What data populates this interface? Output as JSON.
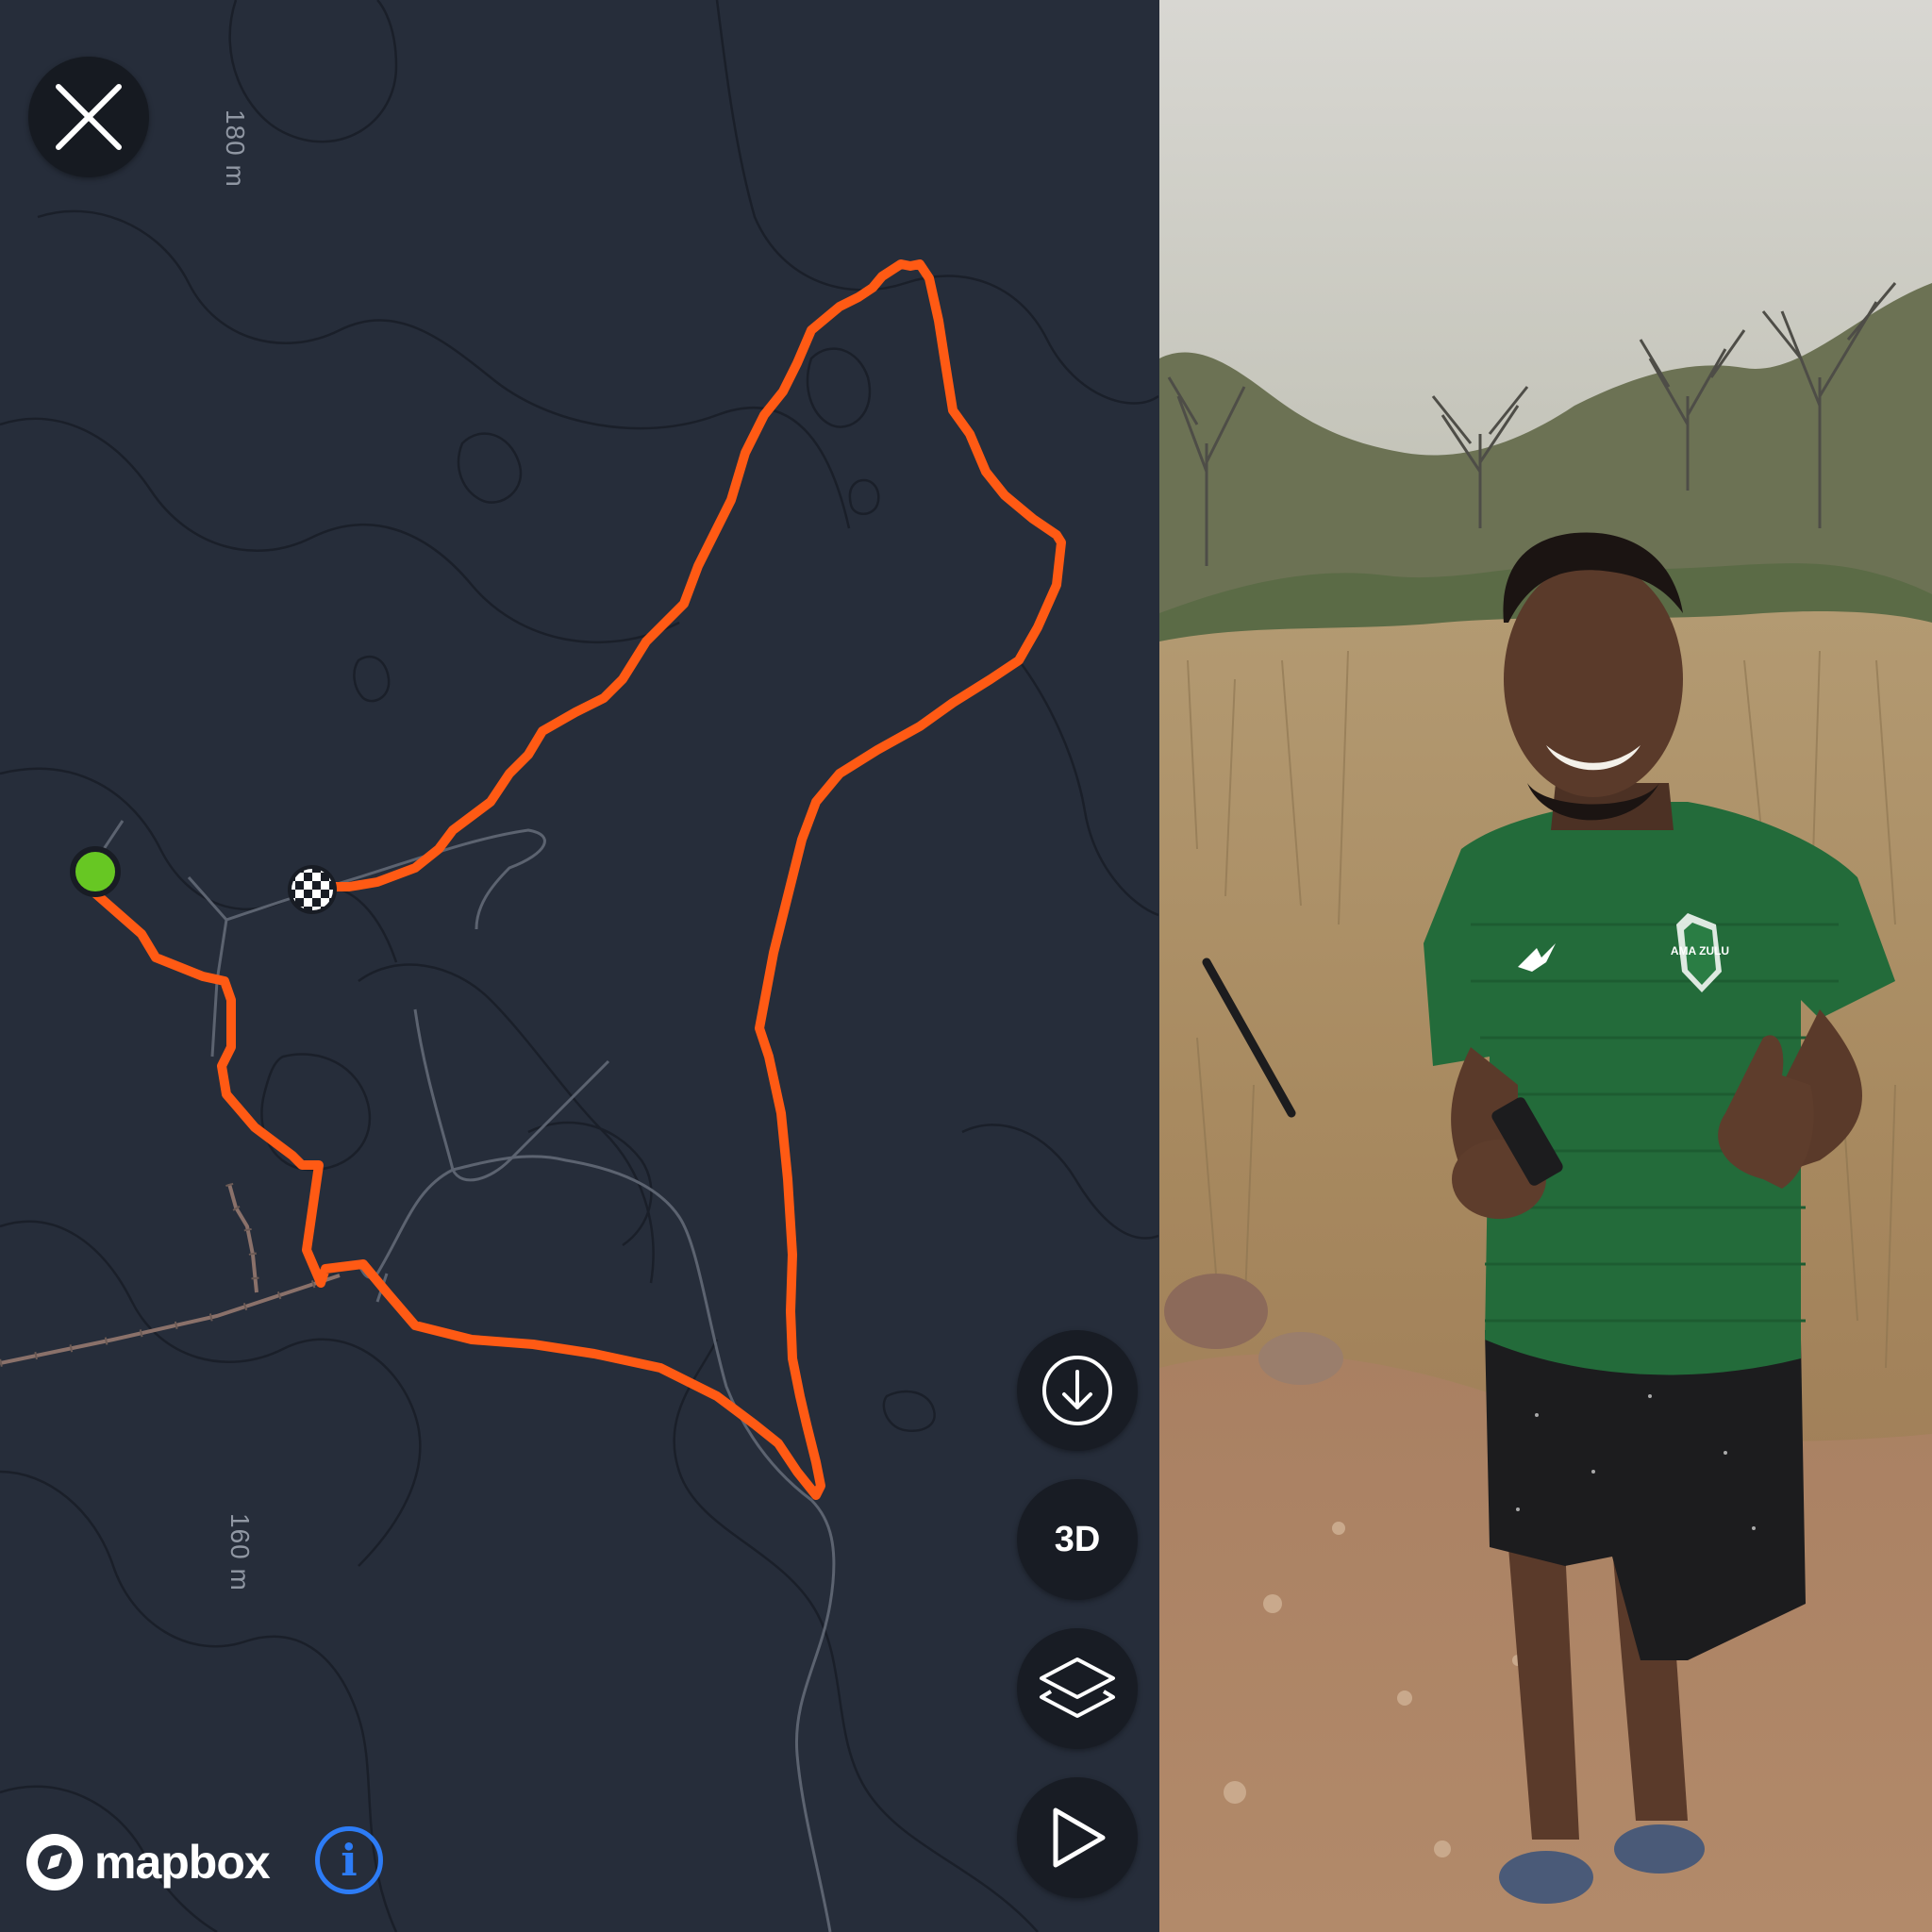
{
  "map": {
    "contour_labels": [
      "180 m",
      "160 m"
    ],
    "track_color": "#ff5a14",
    "start_marker_color": "#67c723",
    "background_color": "#262d3a"
  },
  "controls": {
    "close_icon": "close-icon",
    "download_icon": "download-icon",
    "three_d_label": "3D",
    "layers_icon": "layers-icon",
    "play_icon": "play-icon"
  },
  "attribution": {
    "logo_text": "mapbox",
    "info_symbol": "i"
  },
  "photo": {
    "shirt_badge": "AMA ZULU"
  }
}
